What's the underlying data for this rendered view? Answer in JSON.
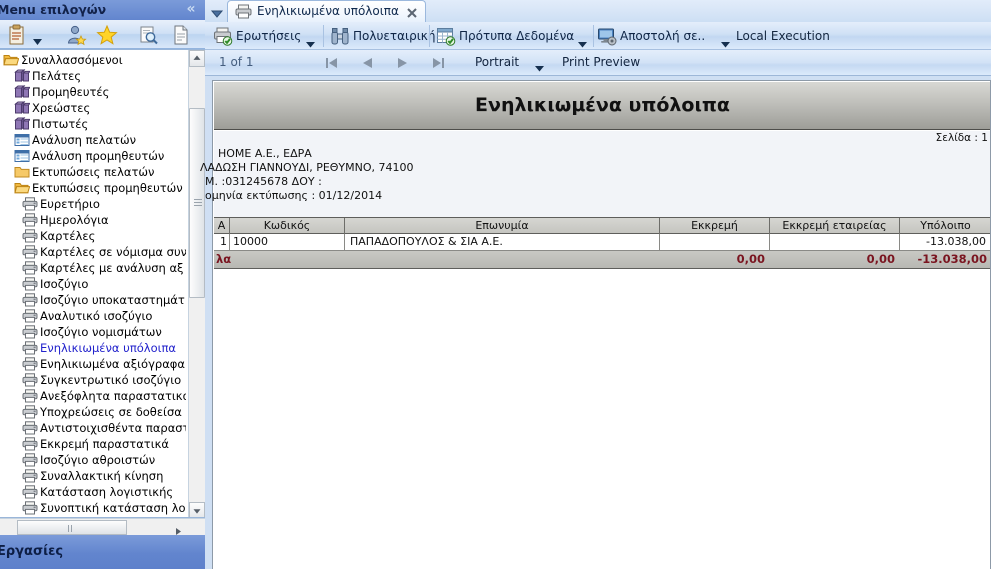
{
  "left_panel": {
    "title": "Menu επιλογών",
    "collapse_icon": "chevron-double-left-icon",
    "toolbar": [
      {
        "name": "clipboard-icon",
        "has_dropdown": true
      },
      {
        "name": "user-favorite-icon",
        "has_dropdown": false
      },
      {
        "name": "star-icon",
        "has_dropdown": false
      },
      {
        "name": "search-icon",
        "has_dropdown": false
      },
      {
        "name": "document-icon",
        "has_dropdown": false
      }
    ],
    "bottom_bar": "Εργασίες",
    "tree": [
      {
        "label": "Συναλλασσόμενοι",
        "icon": "folder-open-icon",
        "level": 1,
        "selected": false
      },
      {
        "label": "Πελάτες",
        "icon": "database-icon",
        "level": 2,
        "selected": false
      },
      {
        "label": "Προμηθευτές",
        "icon": "database-icon",
        "level": 2,
        "selected": false
      },
      {
        "label": "Χρεώστες",
        "icon": "database-icon",
        "level": 2,
        "selected": false
      },
      {
        "label": "Πιστωτές",
        "icon": "database-icon",
        "level": 2,
        "selected": false
      },
      {
        "label": "Ανάλυση πελατών",
        "icon": "grid-icon",
        "level": 2,
        "selected": false
      },
      {
        "label": "Ανάλυση προμηθευτών",
        "icon": "grid-icon",
        "level": 2,
        "selected": false
      },
      {
        "label": "Εκτυπώσεις πελατών",
        "icon": "folder-icon",
        "level": 2,
        "selected": false
      },
      {
        "label": "Εκτυπώσεις προμηθευτών",
        "icon": "folder-open-icon",
        "level": 2,
        "selected": false
      },
      {
        "label": "Ευρετήριο",
        "icon": "printer-icon",
        "level": 3,
        "selected": false
      },
      {
        "label": "Ημερολόγια",
        "icon": "printer-icon",
        "level": 3,
        "selected": false
      },
      {
        "label": "Καρτέλες",
        "icon": "printer-icon",
        "level": 3,
        "selected": false
      },
      {
        "label": "Καρτέλες σε νόμισμα συν",
        "icon": "printer-icon",
        "level": 3,
        "selected": false
      },
      {
        "label": "Καρτέλες με ανάλυση αξ",
        "icon": "printer-icon",
        "level": 3,
        "selected": false
      },
      {
        "label": "Ισοζύγιο",
        "icon": "printer-icon",
        "level": 3,
        "selected": false
      },
      {
        "label": "Ισοζύγιο υποκαταστημάτ",
        "icon": "printer-icon",
        "level": 3,
        "selected": false
      },
      {
        "label": "Αναλυτικό ισοζύγιο",
        "icon": "printer-icon",
        "level": 3,
        "selected": false
      },
      {
        "label": "Ισοζύγιο νομισμάτων",
        "icon": "printer-icon",
        "level": 3,
        "selected": false
      },
      {
        "label": "Ενηλικιωμένα υπόλοιπα",
        "icon": "printer-icon",
        "level": 3,
        "selected": true
      },
      {
        "label": "Ενηλικιωμένα αξιόγραφα",
        "icon": "printer-icon",
        "level": 3,
        "selected": false
      },
      {
        "label": "Συγκεντρωτικό ισοζύγιο",
        "icon": "printer-icon",
        "level": 3,
        "selected": false
      },
      {
        "label": "Ανεξόφλητα παραστατικα",
        "icon": "printer-icon",
        "level": 3,
        "selected": false
      },
      {
        "label": "Υποχρεώσεις σε δοθείσα",
        "icon": "printer-icon",
        "level": 3,
        "selected": false
      },
      {
        "label": "Αντιστοιχισθέντα παραστ",
        "icon": "printer-icon",
        "level": 3,
        "selected": false
      },
      {
        "label": "Εκκρεμή παραστατικά",
        "icon": "printer-icon",
        "level": 3,
        "selected": false
      },
      {
        "label": "Ισοζύγιο αθροιστών",
        "icon": "printer-icon",
        "level": 3,
        "selected": false
      },
      {
        "label": "Συναλλακτική κίνηση",
        "icon": "printer-icon",
        "level": 3,
        "selected": false
      },
      {
        "label": "Κατάσταση λογιστικής",
        "icon": "printer-icon",
        "level": 3,
        "selected": false
      },
      {
        "label": "Συνοπτική κατάσταση λο",
        "icon": "printer-icon",
        "level": 3,
        "selected": false
      }
    ]
  },
  "tab": {
    "label": "Ενηλικιωμένα υπόλοιπα",
    "icon": "printer-icon",
    "close_icon": "close-icon",
    "list_dropdown_icon": "chevron-down-icon"
  },
  "ribbon": {
    "buttons": [
      {
        "label": "Ερωτήσεις",
        "icon": "printer-check-icon",
        "has_dropdown": true
      },
      {
        "label": "Πολυεταιρική",
        "icon": "binoculars-icon",
        "has_dropdown": false
      },
      {
        "label": "Πρότυπα Δεδομένα",
        "icon": "table-check-icon",
        "has_dropdown": true
      },
      {
        "label": "Αποστολή σε..",
        "icon": "monitor-send-icon",
        "has_dropdown": true
      }
    ],
    "execution_mode": "Local Execution"
  },
  "preview_bar": {
    "page_count": "1 of 1",
    "nav": [
      {
        "name": "first-page-button",
        "glyph": "first"
      },
      {
        "name": "previous-page-button",
        "glyph": "prev"
      },
      {
        "name": "next-page-button",
        "glyph": "next"
      },
      {
        "name": "last-page-button",
        "glyph": "last"
      }
    ],
    "orientation": "Portrait",
    "orientation_dropdown_icon": "chevron-down-icon",
    "preview_label": "Print Preview"
  },
  "report": {
    "title": "Ενηλικιωμένα υπόλοιπα",
    "page_label": "Σελίδα : 1",
    "company_line": "HOME A.E., ΕΔΡΑ",
    "address_line": "ΛΑΔΩΣΗ ΓΙΑΝΝΟΥΔΙ, ΡΕΘΥΜΝΟ, 74100",
    "tax_line": "Μ. :031245678 ΔΟΥ :",
    "date_line": "ομηνία εκτύπωσης : 01/12/2014",
    "columns": [
      "Α",
      "Κωδικός",
      "Επωνυμία",
      "Εκκρεμή",
      "Εκκρεμή εταιρείας",
      "Υπόλοιπο"
    ],
    "rows": [
      {
        "index": "1",
        "code": "10000",
        "name": "ΠΑΠΑΔΟΠΟΥΛΟΣ & ΣΙΑ Α.Ε.",
        "pending": "",
        "company_pending": "",
        "balance": "-13.038,00"
      }
    ],
    "totals": {
      "label": "λα",
      "pending": "0,00",
      "company_pending": "0,00",
      "balance": "-13.038,00"
    }
  },
  "colors": {
    "accent_blue": "#6285ce",
    "panel_blue": "#cfdff3",
    "selected_tree_item": "#2222cc",
    "totals_red": "#7a1520",
    "report_title_gray": "#bfbfba"
  }
}
